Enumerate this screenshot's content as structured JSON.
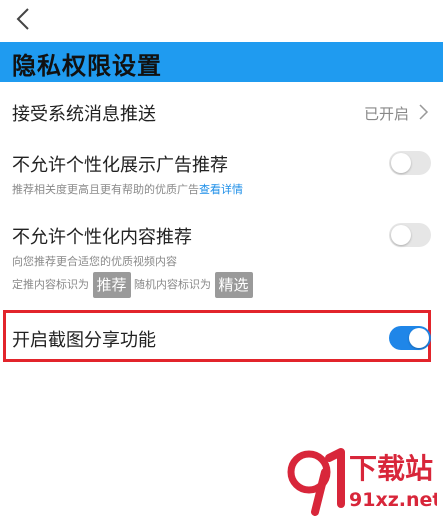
{
  "header": {
    "back_icon": "chevron-left-icon"
  },
  "banner": {
    "title": "隐私权限设置",
    "color": "#1f9bf0"
  },
  "rows": {
    "push": {
      "title": "接受系统消息推送",
      "status": "已开启"
    },
    "ads": {
      "title": "不允许个性化展示广告推荐",
      "desc": "推荐相关度更高且更有帮助的优质广告",
      "link": "查看详情",
      "enabled": false
    },
    "content": {
      "title": "不允许个性化内容推荐",
      "desc": "向您推荐更合适您的优质视频内容",
      "tag_prefix_1": "定推内容标识为",
      "tag_1": "推荐",
      "tag_prefix_2": "随机内容标识为",
      "tag_2": "精选",
      "enabled": false
    },
    "screenshot": {
      "title": "开启截图分享功能",
      "enabled": true
    }
  },
  "colors": {
    "accent": "#1f86e8",
    "highlight_border": "#e2242b",
    "watermark_red": "#d8263a"
  },
  "watermark": {
    "text": "下载站",
    "url": "91xz.net"
  }
}
